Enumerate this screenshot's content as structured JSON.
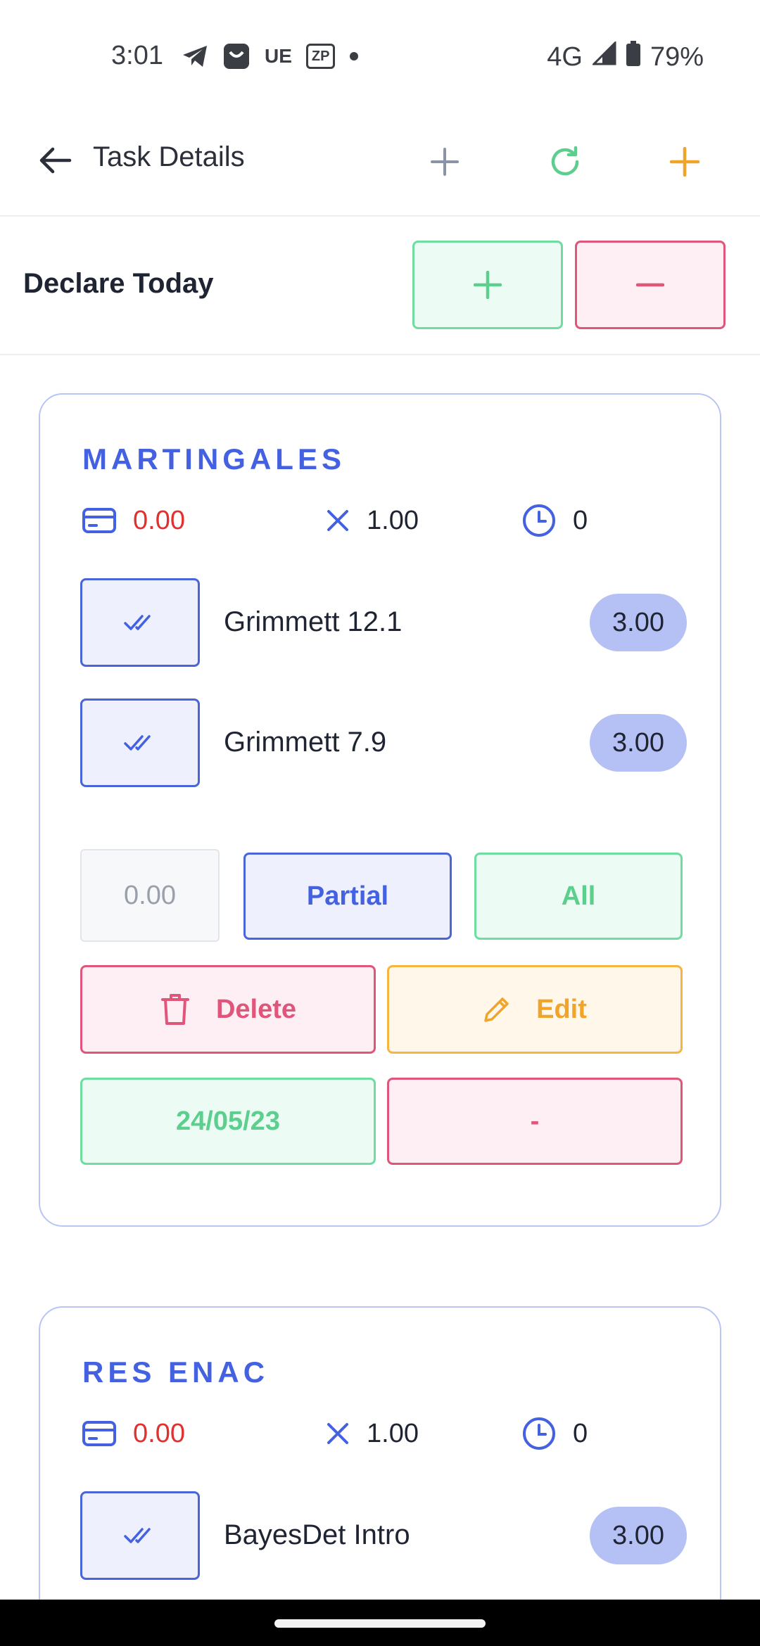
{
  "status_bar": {
    "time": "3:01",
    "icons_left": [
      "telegram-icon",
      "shopping-bag-icon",
      "ue-icon",
      "zp-icon",
      "dot-icon"
    ],
    "ue_text": "UE",
    "zp_text": "ZP",
    "network": "4G",
    "battery": "79%"
  },
  "app_bar": {
    "title": "Task Details",
    "actions": [
      "plus-gray-icon",
      "refresh-green-icon",
      "plus-orange-icon"
    ]
  },
  "declare": {
    "label": "Declare Today"
  },
  "cards": [
    {
      "title": "MARTINGALES",
      "balance": "0.00",
      "multiplier": "1.00",
      "time": "0",
      "tasks": [
        {
          "name": "Grimmett 12.1",
          "value": "3.00"
        },
        {
          "name": "Grimmett 7.9",
          "value": "3.00"
        }
      ],
      "amount_placeholder": "0.00",
      "partial_label": "Partial",
      "all_label": "All",
      "delete_label": "Delete",
      "edit_label": "Edit",
      "date_label": "24/05/23",
      "dash_label": "-"
    },
    {
      "title": "RES ENAC",
      "balance": "0.00",
      "multiplier": "1.00",
      "time": "0",
      "tasks": [
        {
          "name": "BayesDet Intro",
          "value": "3.00"
        }
      ]
    }
  ],
  "colors": {
    "accent_blue": "#4361e0",
    "green": "#5ccf8f",
    "red": "#e0557a",
    "orange": "#f0a52a"
  }
}
